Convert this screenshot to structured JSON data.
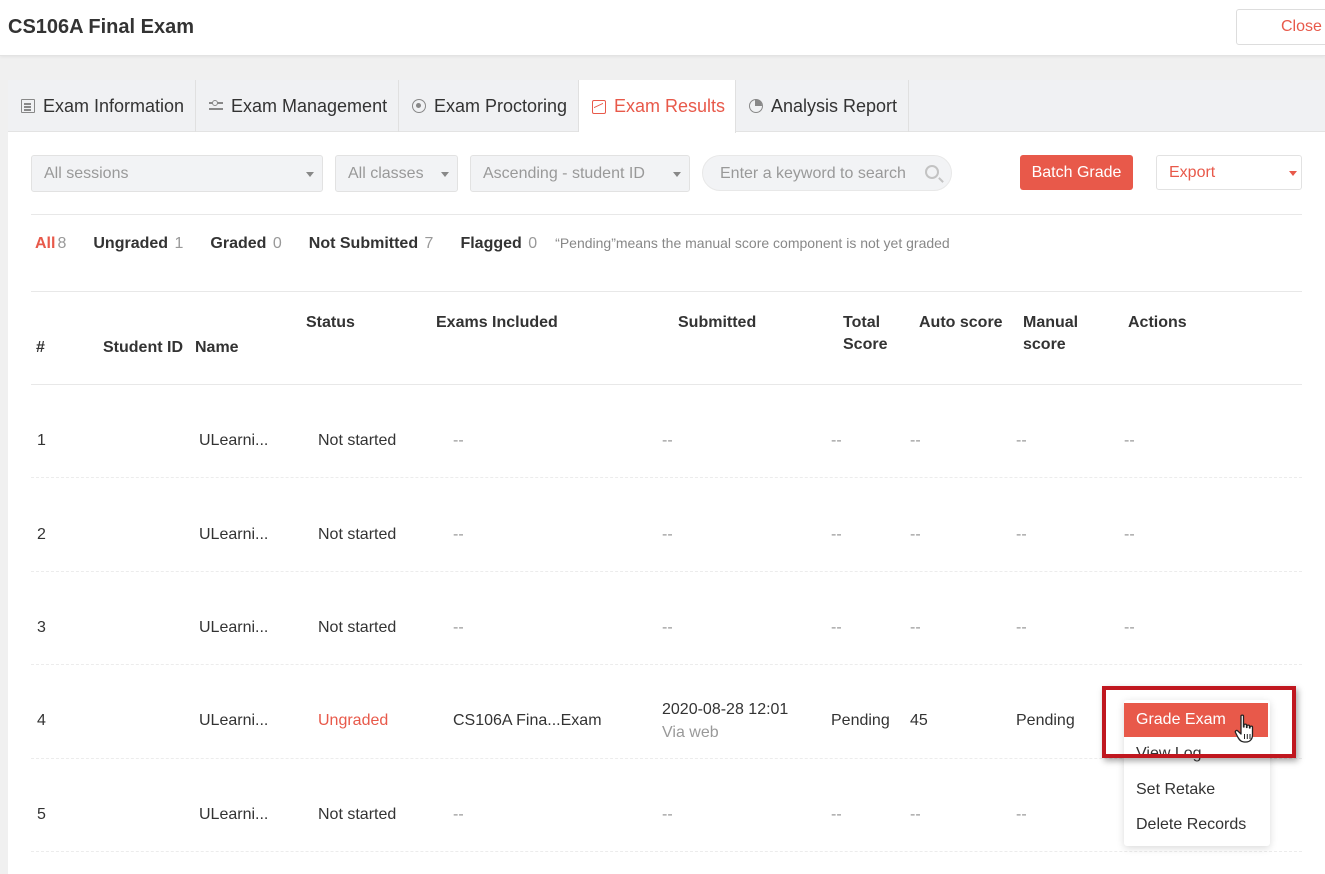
{
  "window": {
    "title": "CS106A Final Exam",
    "close_label": "Close"
  },
  "tabs": [
    {
      "label": "Exam Information",
      "icon": "document-icon"
    },
    {
      "label": "Exam Management",
      "icon": "sliders-icon"
    },
    {
      "label": "Exam Proctoring",
      "icon": "proctor-icon"
    },
    {
      "label": "Exam Results",
      "icon": "chart-icon",
      "active": true
    },
    {
      "label": "Analysis Report",
      "icon": "pie-chart-icon"
    }
  ],
  "toolbar": {
    "sessions": "All sessions",
    "classes": "All classes",
    "sort": "Ascending - student ID",
    "search_placeholder": "Enter a keyword to search",
    "batch_grade": "Batch Grade",
    "export": "Export"
  },
  "filters": {
    "items": [
      {
        "label": "All",
        "count": "8",
        "active": true
      },
      {
        "label": "Ungraded",
        "count": "1"
      },
      {
        "label": "Graded",
        "count": "0"
      },
      {
        "label": "Not Submitted",
        "count": "7"
      },
      {
        "label": "Flagged",
        "count": "0"
      }
    ],
    "note": "“Pending”means the manual score component is not yet graded"
  },
  "table": {
    "headers": {
      "index": "#",
      "student_id": "Student ID",
      "name": "Name",
      "status": "Status",
      "exams_included": "Exams Included",
      "submitted": "Submitted",
      "total_score_1": "Total",
      "total_score_2": "Score",
      "auto_score": "Auto score",
      "manual_score_1": "Manual",
      "manual_score_2": "score",
      "actions": "Actions"
    },
    "rows": [
      {
        "index": "1",
        "name": "ULearni...",
        "status": "Not started",
        "exams": "--",
        "submitted": "--",
        "submitted_via": "",
        "total": "--",
        "auto": "--",
        "manual": "--",
        "actions": "--"
      },
      {
        "index": "2",
        "name": "ULearni...",
        "status": "Not started",
        "exams": "--",
        "submitted": "--",
        "submitted_via": "",
        "total": "--",
        "auto": "--",
        "manual": "--",
        "actions": "--"
      },
      {
        "index": "3",
        "name": "ULearni...",
        "status": "Not started",
        "exams": "--",
        "submitted": "--",
        "submitted_via": "",
        "total": "--",
        "auto": "--",
        "manual": "--",
        "actions": "--"
      },
      {
        "index": "4",
        "name": "ULearni...",
        "status": "Ungraded",
        "exams": "CS106A Fina...Exam",
        "submitted": "2020-08-28 12:01",
        "submitted_via": "Via web",
        "total": "Pending",
        "auto": "45",
        "manual": "Pending",
        "actions": ""
      },
      {
        "index": "5",
        "name": "ULearni...",
        "status": "Not started",
        "exams": "--",
        "submitted": "--",
        "submitted_via": "",
        "total": "--",
        "auto": "--",
        "manual": "--",
        "actions": ""
      }
    ]
  },
  "action_menu": {
    "grade_exam": "Grade Exam",
    "view_log": "View Log",
    "set_retake": "Set Retake",
    "delete_records": "Delete Records"
  },
  "colors": {
    "accent": "#e8594a",
    "highlight": "#c0171f"
  }
}
